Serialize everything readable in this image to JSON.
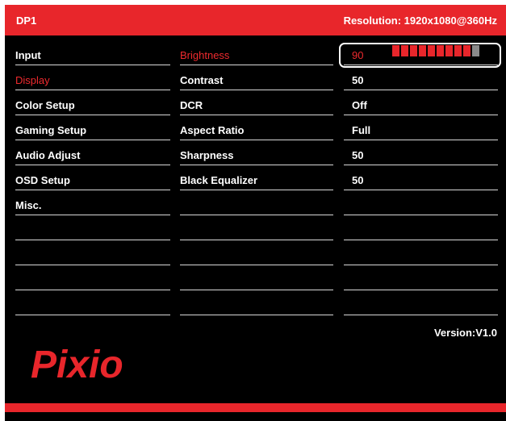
{
  "header": {
    "source": "DP1",
    "resolution": "Resolution: 1920x1080@360Hz"
  },
  "menu": {
    "items": [
      "Input",
      "Display",
      "Color Setup",
      "Gaming Setup",
      "Audio Adjust",
      "OSD Setup",
      "Misc."
    ],
    "active_index": 1
  },
  "settings": {
    "labels": [
      "Brightness",
      "Contrast",
      "DCR",
      "Aspect Ratio",
      "Sharpness",
      "Black Equalizer"
    ],
    "values": [
      "90",
      "50",
      "Off",
      "Full",
      "50",
      "50"
    ],
    "active_index": 0
  },
  "brightness_bar": {
    "level": 90,
    "max": 100
  },
  "version": "Version:V1.0",
  "logo_text": "Pixio",
  "colors": {
    "accent": "#e8262b",
    "background": "#000000",
    "text": "#ffffff"
  }
}
